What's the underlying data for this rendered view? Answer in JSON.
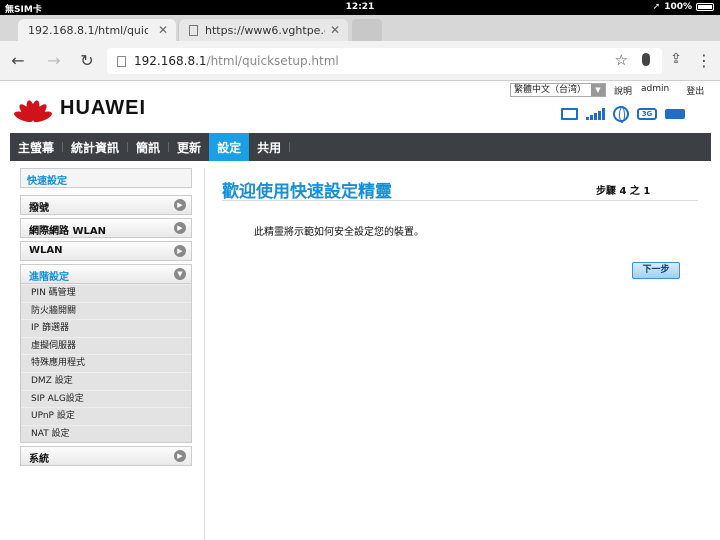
{
  "status_bar": {
    "carrier": "無SIM卡",
    "time": "12:21",
    "battery": "100%"
  },
  "browser": {
    "tabs": [
      {
        "title": "192.168.8.1/html/quicksetu",
        "close": "✕"
      },
      {
        "title": "https://www6.vghtpe.gov.tw",
        "close": "✕"
      }
    ],
    "url_host": "192.168.8.1",
    "url_path": "/html/quicksetup.html"
  },
  "header": {
    "logo_text": "HUAWEI",
    "language": "繁體中文（台湾）",
    "links": [
      "說明",
      "admin",
      "登出"
    ]
  },
  "menu": {
    "items": [
      "主螢幕",
      "統計資訊",
      "簡訊",
      "更新",
      "設定",
      "共用"
    ],
    "selected": "設定"
  },
  "sidebar": {
    "heading": "快速設定",
    "sections": [
      {
        "label": "撥號"
      },
      {
        "label": "網際網路 WLAN"
      },
      {
        "label": "WLAN"
      }
    ],
    "advanced": {
      "label": "進階設定",
      "items": [
        "PIN 碼管理",
        "防火牆開關",
        "IP 篩選器",
        "虛擬伺服器",
        "特殊應用程式",
        "DMZ 設定",
        "SIP ALG設定",
        "UPnP 設定",
        "NAT 設定"
      ]
    },
    "system": {
      "label": "系統"
    }
  },
  "main": {
    "title": "歡迎使用快速設定精靈",
    "step": "步驟 4 之 1",
    "description": "此精靈將示範如何安全設定您的裝置。",
    "next_button": "下一步"
  }
}
